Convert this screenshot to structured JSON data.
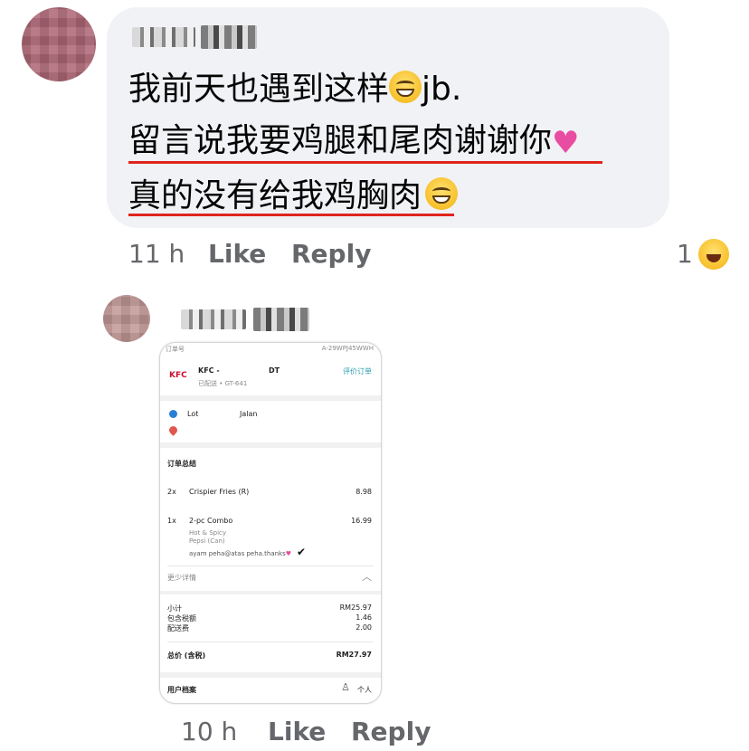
{
  "comment": {
    "lines": [
      "我前天也遇到这样",
      "jb.",
      "留言说我要鸡腿和尾肉谢谢你",
      "真的没有给我鸡胸肉"
    ],
    "time": "11 h",
    "like_label": "Like",
    "reply_label": "Reply",
    "reaction_count": "1",
    "reaction_icon": "haha-icon"
  },
  "reply": {
    "time": "10 h",
    "like_label": "Like",
    "reply_label": "Reply"
  },
  "receipt": {
    "top_left": "订单号",
    "top_right": "A-29WPJ45WWH",
    "store_name": "KFC -",
    "store_code": "DT",
    "rate_link": "评价订单",
    "status": "已配送 • GT-641",
    "address_prefix": "Lot",
    "address_street": "Jalan",
    "summary_title": "订单总结",
    "items": [
      {
        "qty": "2x",
        "name": "Crispier Fries (R)",
        "price": "8.98"
      },
      {
        "qty": "1x",
        "name": "2-pc Combo",
        "price": "16.99",
        "details": [
          "Hot & Spicy",
          "Pepsi (Can)",
          "ayam peha@atas peha.thanks"
        ]
      }
    ],
    "less_details": "更少详情",
    "subtotal_label": "小计",
    "subtotal_value": "RM25.97",
    "tax_label": "包含税额",
    "tax_value": "1.46",
    "delivery_label": "配送费",
    "delivery_value": "2.00",
    "total_label": "总价 (含税)",
    "total_value": "RM27.97",
    "profile_label": "用户档案",
    "personal_label": "个人"
  },
  "colors": {
    "bubble": "#f0f2f5",
    "meta_text": "#65676b",
    "underline": "#e0251d",
    "teal": "#2a9fb0"
  }
}
